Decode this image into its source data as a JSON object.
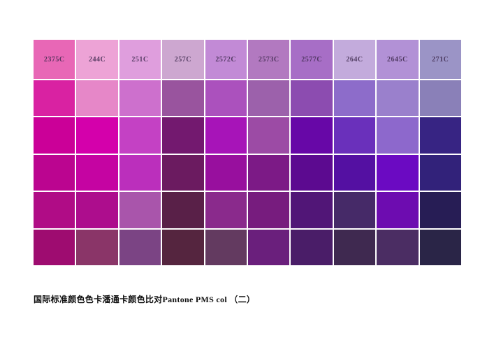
{
  "caption": "国际标准颜色色卡潘通卡颜色比对Pantone PMS col （二）",
  "chart_data": {
    "type": "table",
    "title": "国际标准颜色色卡潘通卡颜色比对Pantone PMS col （二）",
    "rows": 6,
    "label_color": "#3f2b4f",
    "columns": [
      {
        "label": "2375C",
        "shades": [
          "#e867b6",
          "#d922a2",
          "#cb0098",
          "#bb0590",
          "#b00c86",
          "#9e0c70"
        ]
      },
      {
        "label": "244C",
        "shades": [
          "#eda3d6",
          "#e687c8",
          "#d400ab",
          "#c504a2",
          "#ad0d8d",
          "#8a3568"
        ]
      },
      {
        "label": "251C",
        "shades": [
          "#df9edd",
          "#cd70cd",
          "#c441c4",
          "#bb2fbc",
          "#a955ab",
          "#7b4484"
        ]
      },
      {
        "label": "257C",
        "shades": [
          "#cda7d0",
          "#99549e",
          "#73196f",
          "#6b1b60",
          "#592048",
          "#55253f"
        ]
      },
      {
        "label": "2572C",
        "shades": [
          "#c28ad6",
          "#ab51bd",
          "#a714b8",
          "#980f9e",
          "#8a2a8c",
          "#633a60"
        ]
      },
      {
        "label": "2573C",
        "shades": [
          "#b279c0",
          "#9c61ab",
          "#9c4ba5",
          "#7c1a86",
          "#771c7e",
          "#6a1f7c"
        ]
      },
      {
        "label": "2577C",
        "shades": [
          "#a76ec6",
          "#8c4cb0",
          "#6707a7",
          "#5c0a90",
          "#511677",
          "#4a1d68"
        ]
      },
      {
        "label": "264C",
        "shades": [
          "#c3abdc",
          "#8d6cca",
          "#6a30bb",
          "#5410a2",
          "#462a68",
          "#3f2950"
        ]
      },
      {
        "label": "2645C",
        "shades": [
          "#b291d6",
          "#9a80cc",
          "#8d68cc",
          "#6b0ac2",
          "#6d0cb0",
          "#4b2d63"
        ]
      },
      {
        "label": "271C",
        "shades": [
          "#9b94c6",
          "#8a80b8",
          "#372483",
          "#32227a",
          "#271d55",
          "#2a2547"
        ]
      }
    ]
  }
}
